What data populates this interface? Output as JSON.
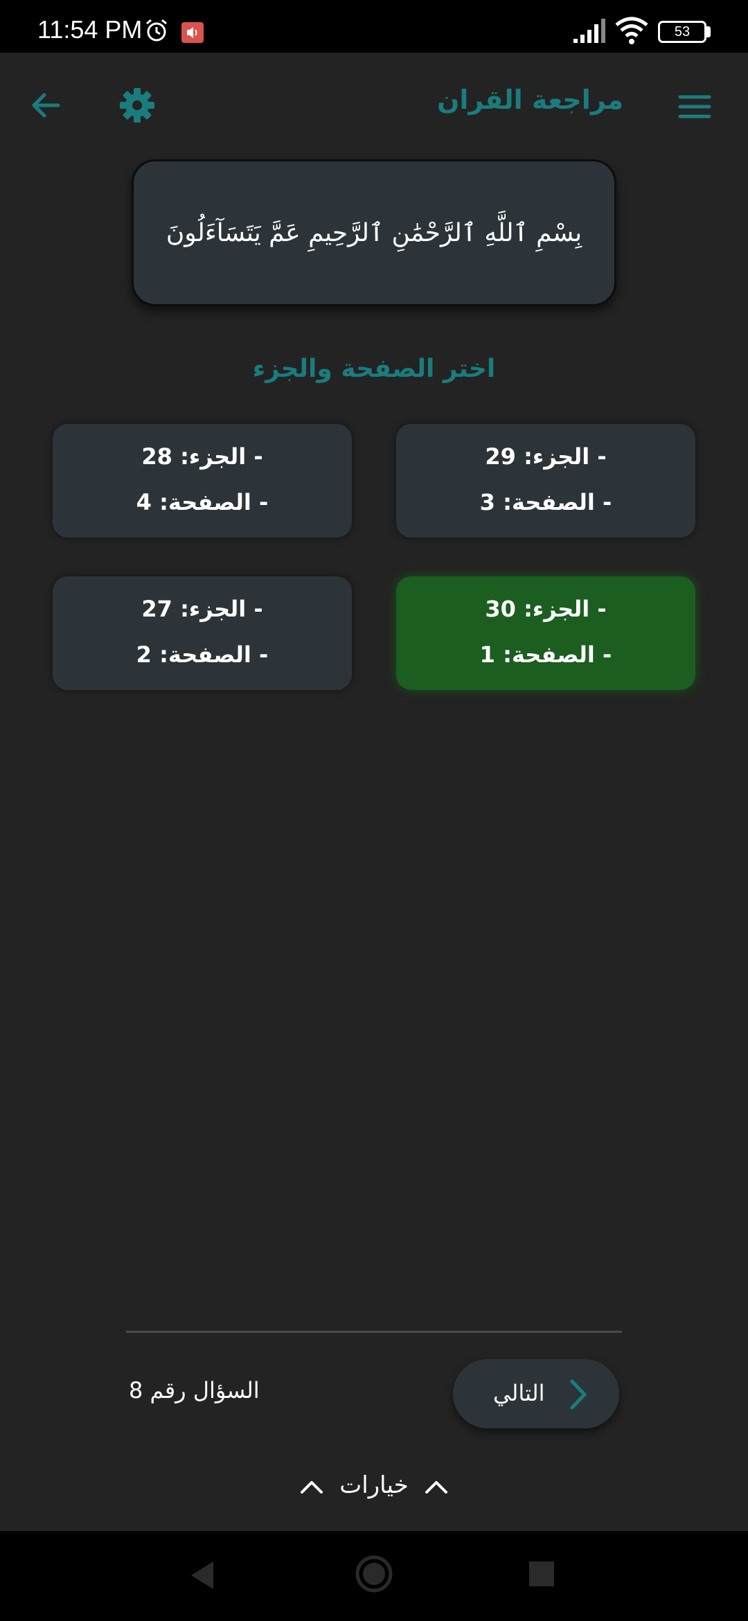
{
  "status_bar": {
    "time": "11:54 PM",
    "battery": "53",
    "icons": [
      "alarm-icon",
      "sound-icon",
      "signal-icon",
      "wifi-icon",
      "battery-icon"
    ]
  },
  "app_bar": {
    "title": "مراجعة القران",
    "icons": [
      "back-arrow-icon",
      "gear-icon",
      "menu-icon"
    ],
    "accent_color": "#1a7c7e"
  },
  "verse": {
    "text": "بِسْمِ ٱللَّهِ ٱلرَّحْمَٰنِ ٱلرَّحِيمِ عَمَّ يَتَسَآءَلُونَ"
  },
  "section_title": "اختر الصفحة والجزء",
  "options": [
    {
      "juz": "- الجزء: 29",
      "page": "- الصفحة: 3",
      "selected": false
    },
    {
      "juz": "- الجزء: 28",
      "page": "- الصفحة: 4",
      "selected": false
    },
    {
      "juz": "- الجزء: 30",
      "page": "- الصفحة: 1",
      "selected": true
    },
    {
      "juz": "- الجزء: 27",
      "page": "- الصفحة: 2",
      "selected": false
    }
  ],
  "selected_color": "#1b5e20",
  "question_label": "السؤال رقم 8",
  "next_button": {
    "label": "التالي"
  },
  "options_toggle": {
    "label": "خيارات"
  },
  "nav_bar": {
    "icons": [
      "nav-back-icon",
      "nav-home-icon",
      "nav-recent-icon"
    ]
  }
}
